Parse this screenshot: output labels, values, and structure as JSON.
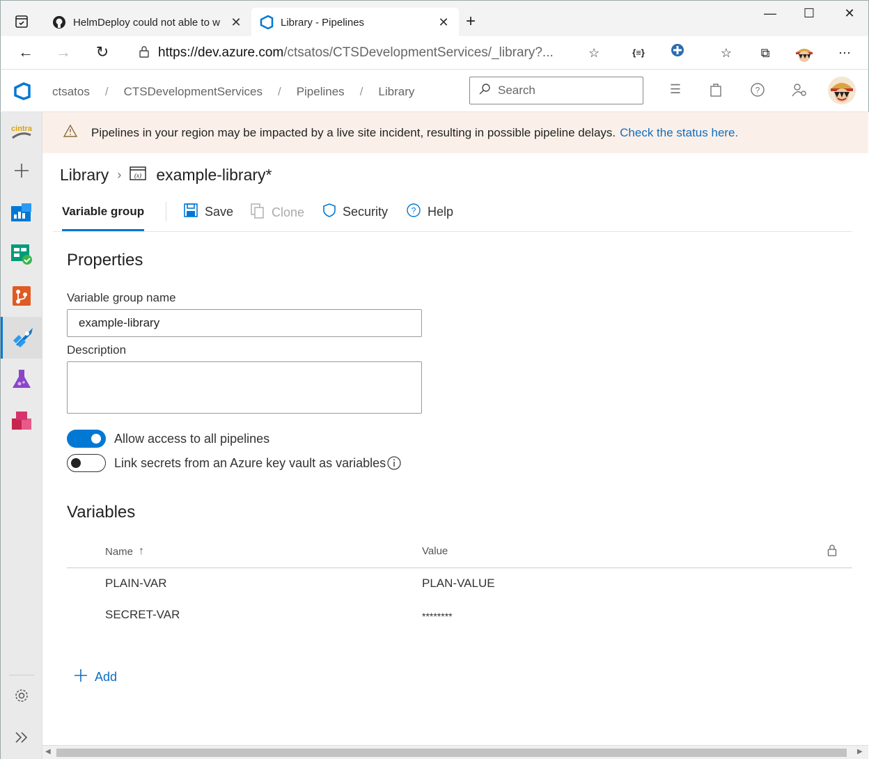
{
  "browser": {
    "tabs": [
      {
        "label": "HelmDeploy could not able to w",
        "icon": "github-icon"
      },
      {
        "label": "Library - Pipelines",
        "icon": "azure-devops-icon"
      }
    ],
    "url_host": "https://dev.azure.com",
    "url_path": "/ctsatos/CTSDevelopmentServices/_library?..."
  },
  "header": {
    "breadcrumbs": [
      "ctsatos",
      "CTSDevelopmentServices",
      "Pipelines",
      "Library"
    ],
    "search_placeholder": "Search"
  },
  "rail": {
    "org_logo_text": "cintra"
  },
  "banner": {
    "message": "Pipelines in your region may be impacted by a live site incident, resulting in possible pipeline delays.",
    "link": "Check the status here."
  },
  "page": {
    "parent": "Library",
    "title": "example-library*"
  },
  "toolbar": {
    "tab": "Variable group",
    "save": "Save",
    "clone": "Clone",
    "security": "Security",
    "help": "Help"
  },
  "properties": {
    "heading": "Properties",
    "name_label": "Variable group name",
    "name_value": "example-library",
    "description_label": "Description",
    "description_value": "",
    "allow_access_label": "Allow access to all pipelines",
    "allow_access_on": true,
    "link_secrets_label": "Link secrets from an Azure key vault as variables",
    "link_secrets_on": false
  },
  "variables": {
    "heading": "Variables",
    "columns": {
      "name": "Name",
      "value": "Value"
    },
    "rows": [
      {
        "name": "PLAIN-VAR",
        "value": "PLAN-VALUE"
      },
      {
        "name": "SECRET-VAR",
        "value": "********"
      }
    ],
    "add_label": "Add"
  },
  "colors": {
    "accent": "#0078d4",
    "link": "#106ebe",
    "banner_bg": "#fbf0e9"
  }
}
